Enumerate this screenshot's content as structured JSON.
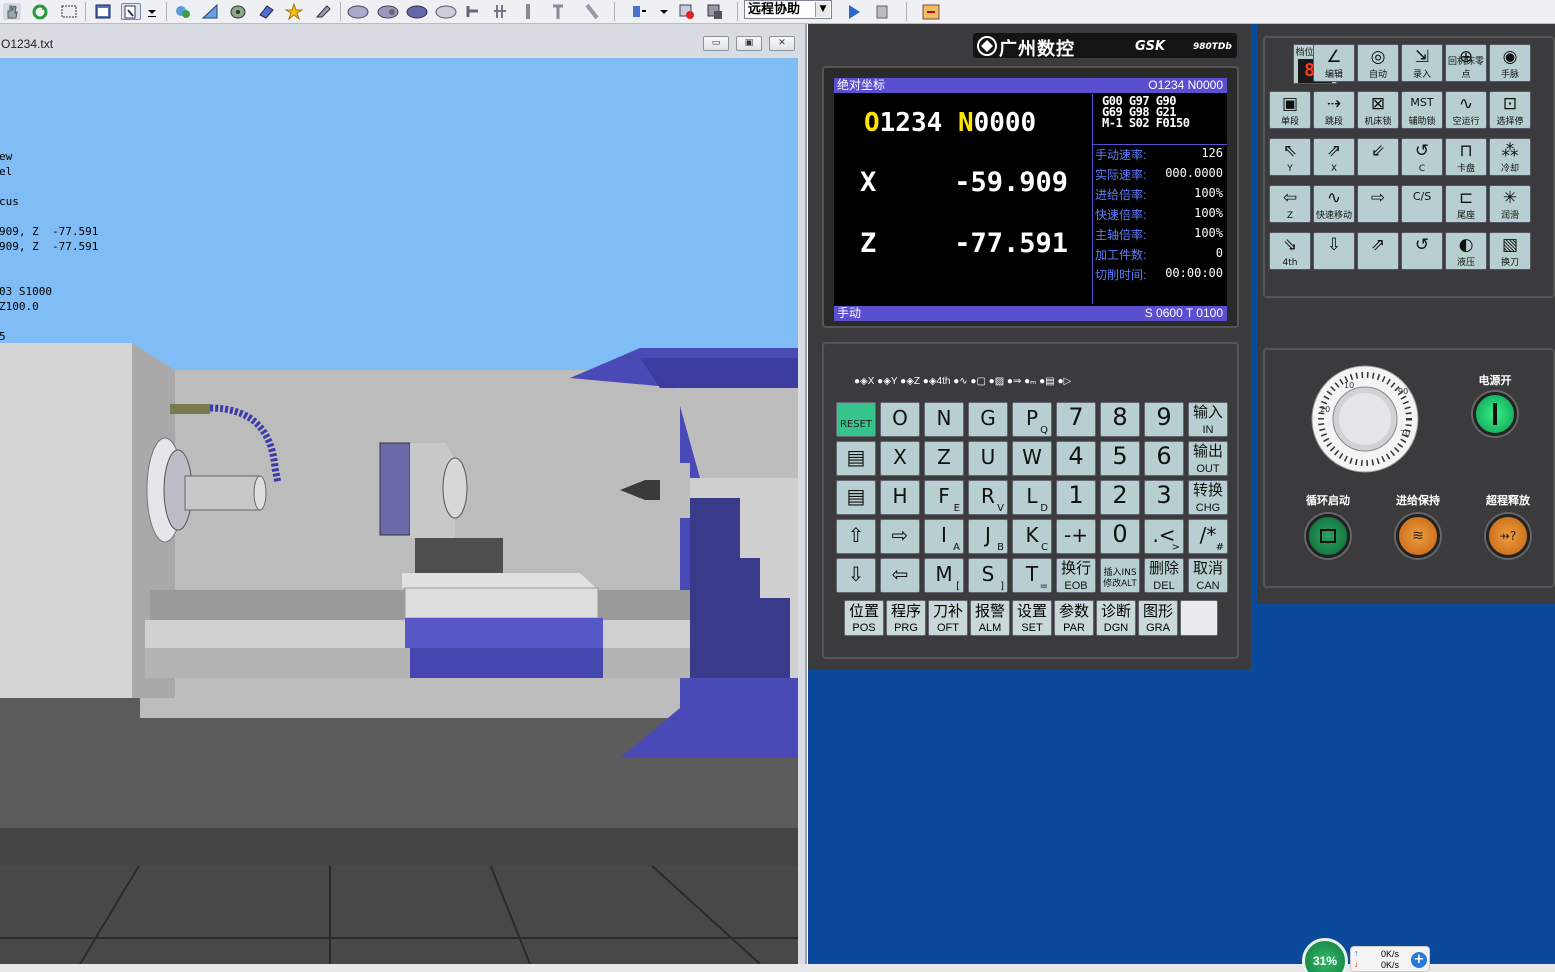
{
  "toolbar": {
    "remote_assist": "远程协助",
    "icons": [
      "hand-icon",
      "refresh-icon",
      "select-rect-icon",
      "window-icon",
      "zoom-icon",
      "dropdown-arrow-icon",
      "puzzle-icon",
      "ruler-icon",
      "measure-icon",
      "eraser-icon",
      "star-icon",
      "tool-icon",
      "fixture-icon",
      "fixture2-icon",
      "fixture3-icon",
      "fixture4-icon",
      "cutter-icon",
      "cutter2-icon",
      "cutter3-icon",
      "cutter4-icon",
      "cutter5-icon",
      "cutter6-icon",
      "flag-icon",
      "record-icon",
      "stop-icon",
      "play-icon",
      "stop2-icon",
      "exit-icon"
    ]
  },
  "sim_window": {
    "title": "O1234.txt",
    "buttons": [
      "▭",
      "▣",
      "✕"
    ],
    "code_lines": [
      "ew",
      "el",
      "",
      "cus",
      "",
      "909, Z  -77.591",
      "909, Z  -77.591",
      "",
      "",
      "03 S1000",
      "Z100.0",
      "",
      "5"
    ]
  },
  "controller": {
    "brand_cn": "广州数控",
    "brand_en": "GSK",
    "brand_model": "980TDb",
    "screen": {
      "header_left": "绝对坐标",
      "header_right": "O1234  N0000",
      "program": "O1234",
      "block": "N0000",
      "x_label": "X",
      "x_value": "-59.909",
      "z_label": "Z",
      "z_value": "-77.591",
      "gcodes": [
        [
          "G00",
          "G97",
          "G90"
        ],
        [
          "G69",
          "G98",
          "G21"
        ],
        [
          "M-1",
          "S02",
          "F0150"
        ]
      ],
      "info": [
        {
          "label": "手动速率:",
          "value": "126"
        },
        {
          "label": "实际速率:",
          "value": "000.0000"
        },
        {
          "label": "进给倍率:",
          "value": "100%"
        },
        {
          "label": "快速倍率:",
          "value": "100%"
        },
        {
          "label": "主轴倍率:",
          "value": "100%"
        },
        {
          "label": "加工件数:",
          "value": "0"
        },
        {
          "label": "切削时间:",
          "value": "00:00:00"
        }
      ],
      "footer_left": "手动",
      "footer_right": "S 0600  T 0100"
    },
    "axis_row": "●◈X ●◈Y ●◈Z ●◈4th ●∿ ●▢ ●▨ ●⇒ ●ₘ ●▤ ●▷",
    "keys": [
      [
        {
          "m": "RESET",
          "s": ""
        },
        {
          "m": "O",
          "s": ""
        },
        {
          "m": "N",
          "s": ""
        },
        {
          "m": "G",
          "s": ""
        },
        {
          "m": "P",
          "s": "Q"
        },
        {
          "m": "7",
          "s": ""
        },
        {
          "m": "8",
          "s": ""
        },
        {
          "m": "9",
          "s": ""
        },
        {
          "cn": "输入",
          "en": "IN"
        }
      ],
      [
        {
          "m": "▤",
          "s": ""
        },
        {
          "m": "X",
          "s": ""
        },
        {
          "m": "Z",
          "s": ""
        },
        {
          "m": "U",
          "s": ""
        },
        {
          "m": "W",
          "s": ""
        },
        {
          "m": "4",
          "s": ""
        },
        {
          "m": "5",
          "s": ""
        },
        {
          "m": "6",
          "s": ""
        },
        {
          "cn": "输出",
          "en": "OUT"
        }
      ],
      [
        {
          "m": "▤",
          "s": ""
        },
        {
          "m": "H",
          "s": ""
        },
        {
          "m": "F",
          "s": "E"
        },
        {
          "m": "R",
          "s": "V"
        },
        {
          "m": "L",
          "s": "D"
        },
        {
          "m": "1",
          "s": ""
        },
        {
          "m": "2",
          "s": ""
        },
        {
          "m": "3",
          "s": ""
        },
        {
          "cn": "转换",
          "en": "CHG"
        }
      ],
      [
        {
          "m": "⇧",
          "s": ""
        },
        {
          "m": "⇨",
          "s": ""
        },
        {
          "m": "I",
          "s": "A"
        },
        {
          "m": "J",
          "s": "B"
        },
        {
          "m": "K",
          "s": "C"
        },
        {
          "m": "-+",
          "s": ""
        },
        {
          "m": "0",
          "s": ""
        },
        {
          "m": ".<",
          "s": ">"
        },
        {
          "m": "/*",
          "s": "#"
        }
      ],
      [
        {
          "m": "⇩",
          "s": ""
        },
        {
          "m": "⇦",
          "s": ""
        },
        {
          "m": "M",
          "s": "["
        },
        {
          "m": "S",
          "s": "]"
        },
        {
          "m": "T",
          "s": "="
        },
        {
          "cn": "换行",
          "en": "EOB"
        },
        {
          "cn": "插入INS",
          "en": "修改ALT"
        },
        {
          "cn": "删除",
          "en": "DEL"
        },
        {
          "cn": "取消",
          "en": "CAN"
        }
      ]
    ],
    "func_keys": [
      {
        "cn": "位置",
        "en": "POS"
      },
      {
        "cn": "程序",
        "en": "PRG"
      },
      {
        "cn": "刀补",
        "en": "OFT"
      },
      {
        "cn": "报警",
        "en": "ALM"
      },
      {
        "cn": "设置",
        "en": "SET"
      },
      {
        "cn": "参数",
        "en": "PAR"
      },
      {
        "cn": "诊断",
        "en": "DGN"
      },
      {
        "cn": "图形",
        "en": "GRA"
      },
      {
        "cn": "",
        "en": ""
      }
    ],
    "op_panel": {
      "tool_label": "档位/刀号",
      "tool_display": "88",
      "rows": [
        [
          {
            "ic": "",
            "lb": ""
          },
          {
            "ic": "∠",
            "lb": "编辑"
          },
          {
            "ic": "◎",
            "lb": "自动"
          },
          {
            "ic": "⇲",
            "lb": "录入"
          },
          {
            "ic": "⊕",
            "lb": "回机床零点"
          },
          {
            "ic": "◉",
            "lb": "手脉"
          }
        ],
        [
          {
            "ic": "▣",
            "lb": "单段"
          },
          {
            "ic": "⇢",
            "lb": "跳段"
          },
          {
            "ic": "⊠",
            "lb": "机床锁"
          },
          {
            "ic": "MST",
            "lb": "辅助锁"
          },
          {
            "ic": "∿",
            "lb": "空运行"
          },
          {
            "ic": "⊡",
            "lb": "选择停"
          }
        ],
        [
          {
            "ic": "⇖",
            "lb": "Y"
          },
          {
            "ic": "⇗",
            "lb": "X"
          },
          {
            "ic": "⇙",
            "lb": ""
          },
          {
            "ic": "↺",
            "lb": "C"
          },
          {
            "ic": "⊓",
            "lb": "卡盘"
          },
          {
            "ic": "⁂",
            "lb": "冷却"
          }
        ],
        [
          {
            "ic": "⇦",
            "lb": "Z"
          },
          {
            "ic": "∿",
            "lb": "快速移动"
          },
          {
            "ic": "⇨",
            "lb": ""
          },
          {
            "ic": "C/S",
            "lb": ""
          },
          {
            "ic": "⊏",
            "lb": "尾座"
          },
          {
            "ic": "✳",
            "lb": "润滑"
          }
        ],
        [
          {
            "ic": "⇘",
            "lb": "4th"
          },
          {
            "ic": "⇩",
            "lb": ""
          },
          {
            "ic": "⇗",
            "lb": ""
          },
          {
            "ic": "↺",
            "lb": ""
          },
          {
            "ic": "◐",
            "lb": "液压"
          },
          {
            "ic": "▧",
            "lb": "换刀"
          }
        ]
      ]
    },
    "power_label": "电源开",
    "cycle_start": "循环启动",
    "feed_hold": "进给保持",
    "overtravel": "超程释放"
  },
  "status": {
    "cpu": "31%",
    "up": "0K/s",
    "down": "0K/s"
  }
}
